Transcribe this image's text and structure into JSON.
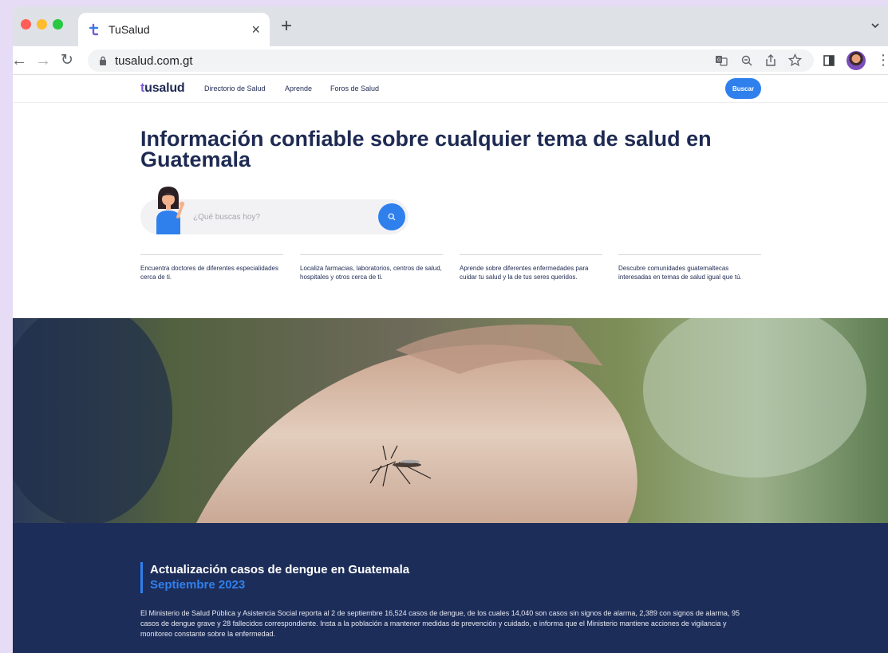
{
  "browser": {
    "tab_title": "TuSalud",
    "url": "tusalud.com.gt",
    "new_tab_glyph": "+",
    "close_glyph": "×",
    "icons": [
      "back-icon",
      "forward-icon",
      "reload-icon",
      "lock-icon",
      "translate-icon",
      "zoom-icon",
      "share-icon",
      "bookmark-star-icon",
      "side-panel-icon",
      "profile-avatar",
      "menu-kebab-icon",
      "tab-search-chevron-icon"
    ]
  },
  "site": {
    "logo_prefix": "t",
    "logo_rest": "usalud",
    "nav": {
      "directorio": "Directorio de Salud",
      "aprende": "Aprende",
      "foros": "Foros de Salud"
    },
    "buscar_label": "Buscar",
    "hero_title": "Información confiable sobre cualquier tema de salud en Guatemala",
    "search_placeholder": "¿Qué buscas hoy?",
    "features": [
      "Encuentra doctores de diferentes especialidades cerca de ti.",
      "Localiza farmacias, laboratorios, centros de salud, hospitales y otros cerca de ti.",
      "Aprende sobre diferentes enfermedades para cuidar tu salud y la de tus seres queridos.",
      "Descubre comunidades guatemaltecas interesadas en temas de salud igual que tú."
    ],
    "update": {
      "title": "Actualización casos de dengue en Guatemala",
      "subtitle": "Septiembre 2023",
      "body": "El Ministerio de Salud Pública y Asistencia Social reporta al 2 de septiembre 16,524 casos de dengue, de los cuales 14,040 son casos sin signos de alarma, 2,389 con signos de alarma, 95 casos de dengue grave y 28 fallecidos correspondiente. Insta a la población a mantener medidas de prevención y cuidado, e informa que el Ministerio mantiene acciones de vigilancia y monitoreo constante sobre la enfermedad."
    }
  },
  "colors": {
    "brand_navy": "#1e2a52",
    "brand_blue": "#2f80ed",
    "brand_purple": "#7a59d6",
    "dark_section": "#1d2d59"
  }
}
